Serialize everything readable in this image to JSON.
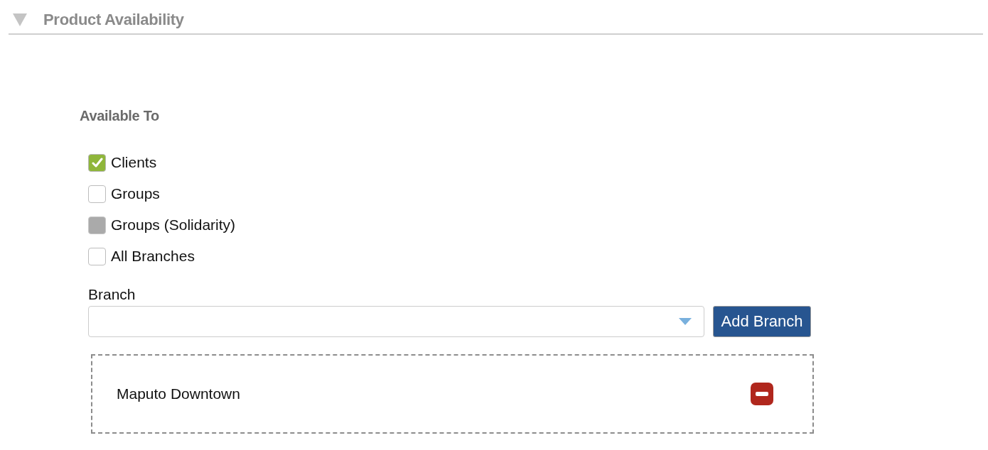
{
  "section": {
    "title": "Product Availability",
    "expanded": true
  },
  "available_to": {
    "heading": "Available To",
    "options": [
      {
        "label": "Clients",
        "checked": true,
        "disabled": false
      },
      {
        "label": "Groups",
        "checked": false,
        "disabled": false
      },
      {
        "label": "Groups (Solidarity)",
        "checked": false,
        "disabled": true
      },
      {
        "label": "All Branches",
        "checked": false,
        "disabled": false
      }
    ]
  },
  "branch": {
    "label": "Branch",
    "button": "Add Branch"
  },
  "branches": [
    {
      "name": "Maputo Downtown"
    }
  ]
}
